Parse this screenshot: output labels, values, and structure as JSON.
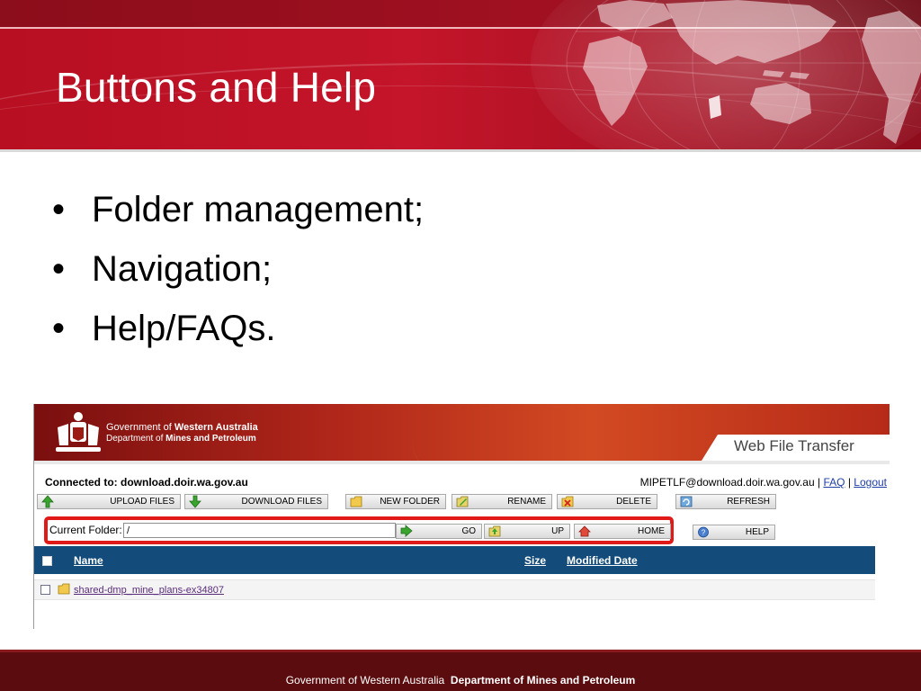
{
  "slide": {
    "title": "Buttons and Help",
    "bullets": [
      "Folder management;",
      "Navigation;",
      "Help/FAQs."
    ],
    "bullet_char": "•"
  },
  "app": {
    "banner": {
      "gov_line_prefix": "Government of ",
      "gov_line_bold": "Western Australia",
      "dept_line_prefix": "Department of ",
      "dept_line_bold": "Mines and Petroleum",
      "product_title": "Web File Transfer"
    },
    "connected_text": "Connected to: download.doir.wa.gov.au",
    "user": {
      "account": "MIPETLF@download.doir.wa.gov.au",
      "separator": "|",
      "faq_label": "FAQ",
      "logout_label": "Logout"
    },
    "toolbar": {
      "upload": "UPLOAD FILES",
      "download": "DOWNLOAD FILES",
      "new_folder": "NEW FOLDER",
      "rename": "RENAME",
      "delete": "DELETE",
      "refresh": "REFRESH"
    },
    "folder_bar": {
      "label": "Current Folder:",
      "value": "/",
      "go": "GO",
      "up": "UP",
      "home": "HOME",
      "help": "HELP"
    },
    "table": {
      "columns": [
        "Name",
        "Size",
        "Modified Date"
      ],
      "rows": [
        {
          "name": "shared-dmp_mine_plans-ex34807",
          "size": "",
          "modified": ""
        }
      ]
    }
  },
  "footer": {
    "prefix": "Government of Western Australia",
    "bold": "Department of Mines and Petroleum"
  },
  "colors": {
    "header_red": "#c4152a",
    "footer_maroon": "#5b0c0e",
    "table_header_blue": "#134b7a",
    "highlight_red": "#e01919",
    "link_blue": "#1f3ea5"
  },
  "icons": {
    "upload": "green-up-arrow-icon",
    "download": "green-down-arrow-icon",
    "new_folder": "folder-icon",
    "rename": "pencil-folder-icon",
    "delete": "delete-folder-icon",
    "refresh": "refresh-icon",
    "go": "green-right-arrow-icon",
    "up": "folder-up-icon",
    "home": "home-icon",
    "help": "help-icon"
  }
}
